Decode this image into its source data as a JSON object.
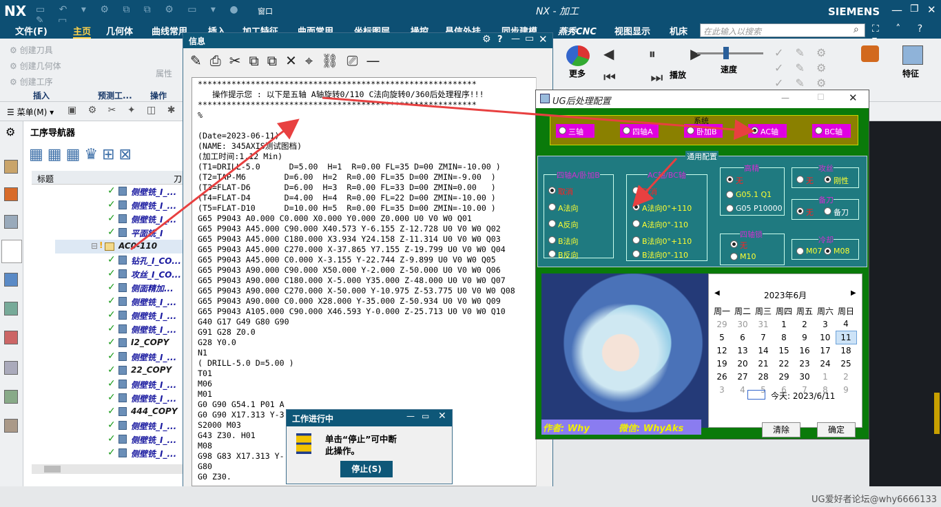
{
  "app": {
    "logo": "NX",
    "title": "NX - 加工",
    "brand": "SIEMENS",
    "window_menu": "窗口"
  },
  "menu": {
    "items": [
      "文件(F)",
      "主页",
      "几何体",
      "曲线常用",
      "插入",
      "加工特征",
      "曲面常用",
      "坐标图层",
      "操控",
      "昌信外挂",
      "同步建模",
      "燕秀CNC",
      "视图显示",
      "机床"
    ],
    "search_placeholder": "在此输入以搜索"
  },
  "ribbon": {
    "left_items": [
      "创建刀具",
      "创建几何体",
      "创建工序"
    ],
    "groups": [
      "插入",
      "预测工...",
      "操作"
    ],
    "attr": "属性",
    "more": "更多",
    "play": "播放",
    "speed": "速度",
    "feature": "特征"
  },
  "toolbar2": {
    "menu": "菜单(M)"
  },
  "navigator": {
    "title": "工序导航器",
    "col_name": "标题",
    "col_tool": "刀",
    "rows": [
      {
        "label": "侧壁铣_I_...",
        "type": "op"
      },
      {
        "label": "侧壁铣_I_...",
        "type": "op"
      },
      {
        "label": "侧壁铣_I_...",
        "type": "op"
      },
      {
        "label": "平面铣_I",
        "type": "op"
      },
      {
        "label": "AC0-110",
        "type": "group"
      },
      {
        "label": "钻孔_I_CO...",
        "type": "op"
      },
      {
        "label": "攻丝_I_CO...",
        "type": "op"
      },
      {
        "label": "侧面精加...",
        "type": "op"
      },
      {
        "label": "侧壁铣_I_...",
        "type": "op"
      },
      {
        "label": "侧壁铣_I_...",
        "type": "op"
      },
      {
        "label": "侧壁铣_I_...",
        "type": "op"
      },
      {
        "label": "I2_COPY",
        "type": "op"
      },
      {
        "label": "侧壁铣_I_...",
        "type": "op"
      },
      {
        "label": "22_COPY",
        "type": "op"
      },
      {
        "label": "侧壁铣_I_...",
        "type": "op"
      },
      {
        "label": "侧壁铣_I_...",
        "type": "op"
      },
      {
        "label": "444_COPY",
        "type": "op"
      },
      {
        "label": "侧壁铣_I_...",
        "type": "op"
      },
      {
        "label": "侧壁铣_I_...",
        "type": "op"
      },
      {
        "label": "侧壁铣_I_...",
        "type": "op"
      }
    ]
  },
  "info": {
    "title": "信息",
    "lines": [
      "**********************************************************",
      "   操作提示您 : 以下是五轴 A轴旋转0/110 C法向旋转0/360后处理程序!!!",
      "**********************************************************",
      "%",
      "",
      "(Date=2023-06-11)",
      "(NAME: 345AXIS测试图档)",
      "(加工时间:1.12 Min)",
      "(T1=DRILL-5.0      D=5.00  H=1  R=0.00 FL=35 D=00 ZMIN=-10.00 )",
      "(T2=TAP-M6        D=6.00  H=2  R=0.00 FL=35 D=00 ZMIN=-9.00  )",
      "(T3=FLAT-D6       D=6.00  H=3  R=0.00 FL=33 D=00 ZMIN=0.00   )",
      "(T4=FLAT-D4       D=4.00  H=4  R=0.00 FL=22 D=00 ZMIN=-10.00 )",
      "(T5=FLAT-D10      D=10.00 H=5  R=0.00 FL=35 D=00 ZMIN=-10.00 )",
      "G65 P9043 A0.000 C0.000 X0.000 Y0.000 Z0.000 U0 V0 W0 Q01",
      "G65 P9043 A45.000 C90.000 X40.573 Y-6.155 Z-12.728 U0 V0 W0 Q02",
      "G65 P9043 A45.000 C180.000 X3.934 Y24.158 Z-11.314 U0 V0 W0 Q03",
      "G65 P9043 A45.000 C270.000 X-37.865 Y7.155 Z-19.799 U0 V0 W0 Q04",
      "G65 P9043 A45.000 C0.000 X-3.155 Y-22.744 Z-9.899 U0 V0 W0 Q05",
      "G65 P9043 A90.000 C90.000 X50.000 Y-2.000 Z-50.000 U0 V0 W0 Q06",
      "G65 P9043 A90.000 C180.000 X-5.000 Y35.000 Z-48.000 U0 V0 W0 Q07",
      "G65 P9043 A90.000 C270.000 X-50.000 Y-10.975 Z-53.775 U0 V0 W0 Q08",
      "G65 P9043 A90.000 C0.000 X28.000 Y-35.000 Z-50.934 U0 V0 W0 Q09",
      "G65 P9043 A105.000 C90.000 X46.593 Y-0.000 Z-25.713 U0 V0 W0 Q10",
      "G40 G17 G49 G80 G90",
      "G91 G28 Z0.0",
      "G28 Y0.0",
      "N1",
      "( DRILL-5.0 D=5.00 )",
      "T01",
      "M06",
      "M01",
      "G0 G90 G54.1 P01 A",
      "G0 G90 X17.313 Y-3",
      "S2000 M03",
      "G43 Z30. H01",
      "M08",
      "G98 G83 X17.313 Y-",
      "G80",
      "G0 Z30."
    ]
  },
  "work": {
    "title": "工作进行中",
    "msg1": "单击“停止”可中断",
    "msg2": "此操作。",
    "stop": "停止(S)"
  },
  "cfg": {
    "title": "UG后处理配置",
    "sys_title": "系统",
    "sys_opts": [
      "三轴",
      "四轴A",
      "卧加B",
      "AC轴",
      "BC轴"
    ],
    "sys_selected": 3,
    "general_title": "通用配置",
    "g1_title": "四轴A/卧加B",
    "g1_opts": [
      "取消",
      "A法向",
      "A反向",
      "B法向",
      "B反向"
    ],
    "g2_title": "AC轴/BC轴",
    "g2_opts": [
      "取消",
      "A法向0°+110",
      "A法向0°-110",
      "B法向0°+110",
      "B法向0°-110"
    ],
    "g3_title": "高精",
    "g3_opts": [
      "无",
      "G05.1 Q1",
      "G05 P10000"
    ],
    "g4_title": "攻丝",
    "g4_opts": [
      "无",
      "刚性"
    ],
    "g5_title": "备刀",
    "g5_opts": [
      "无",
      "备刀"
    ],
    "g6_title": "四轴锁",
    "g6_opts": [
      "无",
      "M10"
    ],
    "g7_title": "冷却",
    "g7_opts": [
      "M07",
      "M08"
    ],
    "author": "作者: Why",
    "wechat": "微信: WhyAks",
    "clear": "清除",
    "ok": "确定",
    "cal_month": "2023年6月",
    "cal_days": [
      "周一",
      "周二",
      "周三",
      "周四",
      "周五",
      "周六",
      "周日"
    ],
    "cal_rows": [
      [
        "29",
        "30",
        "31",
        "1",
        "2",
        "3",
        "4"
      ],
      [
        "5",
        "6",
        "7",
        "8",
        "9",
        "10",
        "11"
      ],
      [
        "12",
        "13",
        "14",
        "15",
        "16",
        "17",
        "18"
      ],
      [
        "19",
        "20",
        "21",
        "22",
        "23",
        "24",
        "25"
      ],
      [
        "26",
        "27",
        "28",
        "29",
        "30",
        "1",
        "2"
      ],
      [
        "3",
        "4",
        "5",
        "6",
        "7",
        "8",
        "9"
      ]
    ],
    "cal_today": "今天: 2023/6/11"
  },
  "watermark": "UG爱好者论坛@why6666133",
  "colors": {
    "nx_blue": "#0d4f73",
    "cfg_green": "#0a7a0a",
    "cfg_teal": "#1f7a80",
    "magenta": "#e000e0",
    "arrow": "#e84040"
  }
}
